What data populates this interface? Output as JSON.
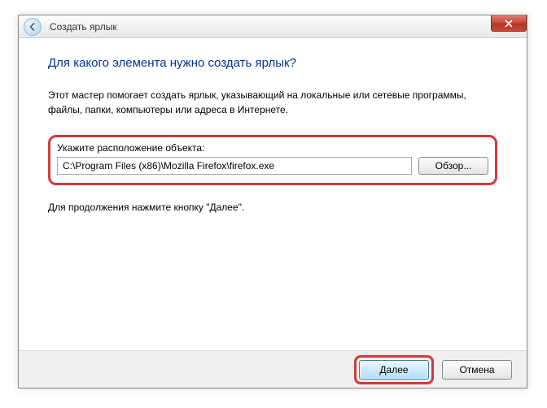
{
  "titlebar": {
    "title": "Создать ярлык"
  },
  "content": {
    "heading": "Для какого элемента нужно создать ярлык?",
    "description": "Этот мастер помогает создать ярлык, указывающий на локальные или сетевые программы, файлы, папки, компьютеры или адреса в Интернете.",
    "field_label": "Укажите расположение объекта:",
    "path_value": "C:\\Program Files (x86)\\Mozilla Firefox\\firefox.exe",
    "browse_label": "Обзор...",
    "continue_hint": "Для продолжения нажмите кнопку \"Далее\"."
  },
  "footer": {
    "next_label": "Далее",
    "cancel_label": "Отмена"
  }
}
